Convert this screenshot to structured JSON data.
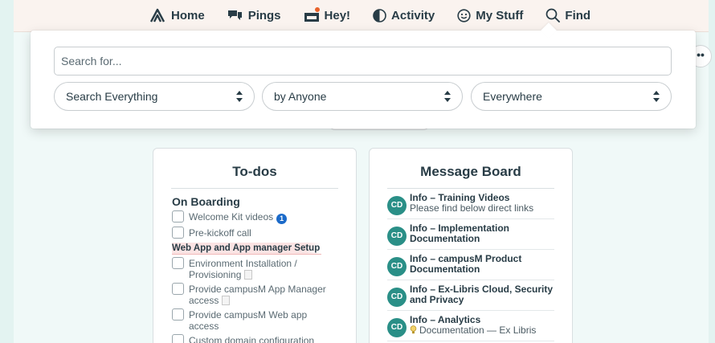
{
  "nav": {
    "items": [
      {
        "label": "Home",
        "icon": "home-icon"
      },
      {
        "label": "Pings",
        "icon": "chat-bubbles-icon"
      },
      {
        "label": "Hey!",
        "icon": "hey-inbox-icon"
      },
      {
        "label": "Activity",
        "icon": "activity-icon"
      },
      {
        "label": "My Stuff",
        "icon": "smiley-icon"
      },
      {
        "label": "Find",
        "icon": "search-icon"
      }
    ]
  },
  "search": {
    "placeholder": "Search for...",
    "type_select": "Search Everything",
    "people_select": "by Anyone",
    "where_select": "Everywhere"
  },
  "more_button": "••",
  "todos": {
    "title": "To-dos",
    "group1": "On Boarding",
    "items1": [
      "Welcome Kit videos",
      "Pre-kickoff call"
    ],
    "group2": "Web App and App manager Setup",
    "items2": [
      "Environment Installation / Provisioning",
      "Provide campusM App Manager access",
      "Provide campusM Web app access",
      "Custom domain configuration"
    ],
    "info_badge": "1"
  },
  "board": {
    "title": "Message Board",
    "messages": [
      {
        "avatar": "CD",
        "title": "Info – Training Videos",
        "excerpt": "Please find below direct links"
      },
      {
        "avatar": "CD",
        "title": "Info – Implementation Documentation",
        "excerpt": ""
      },
      {
        "avatar": "CD",
        "title": "Info – campusM Product Documentation",
        "excerpt": ""
      },
      {
        "avatar": "CD",
        "title": "Info – Ex-Libris Cloud, Security and Privacy",
        "excerpt": ""
      },
      {
        "avatar": "CD",
        "title": "Info – Analytics",
        "excerpt": "Documentation — Ex Libris"
      }
    ]
  },
  "colors": {
    "brand_teal": "#2a8f87",
    "nav_bg": "#faf3ef",
    "notification": "#e8622a",
    "info_blue": "#1b6ac9"
  }
}
